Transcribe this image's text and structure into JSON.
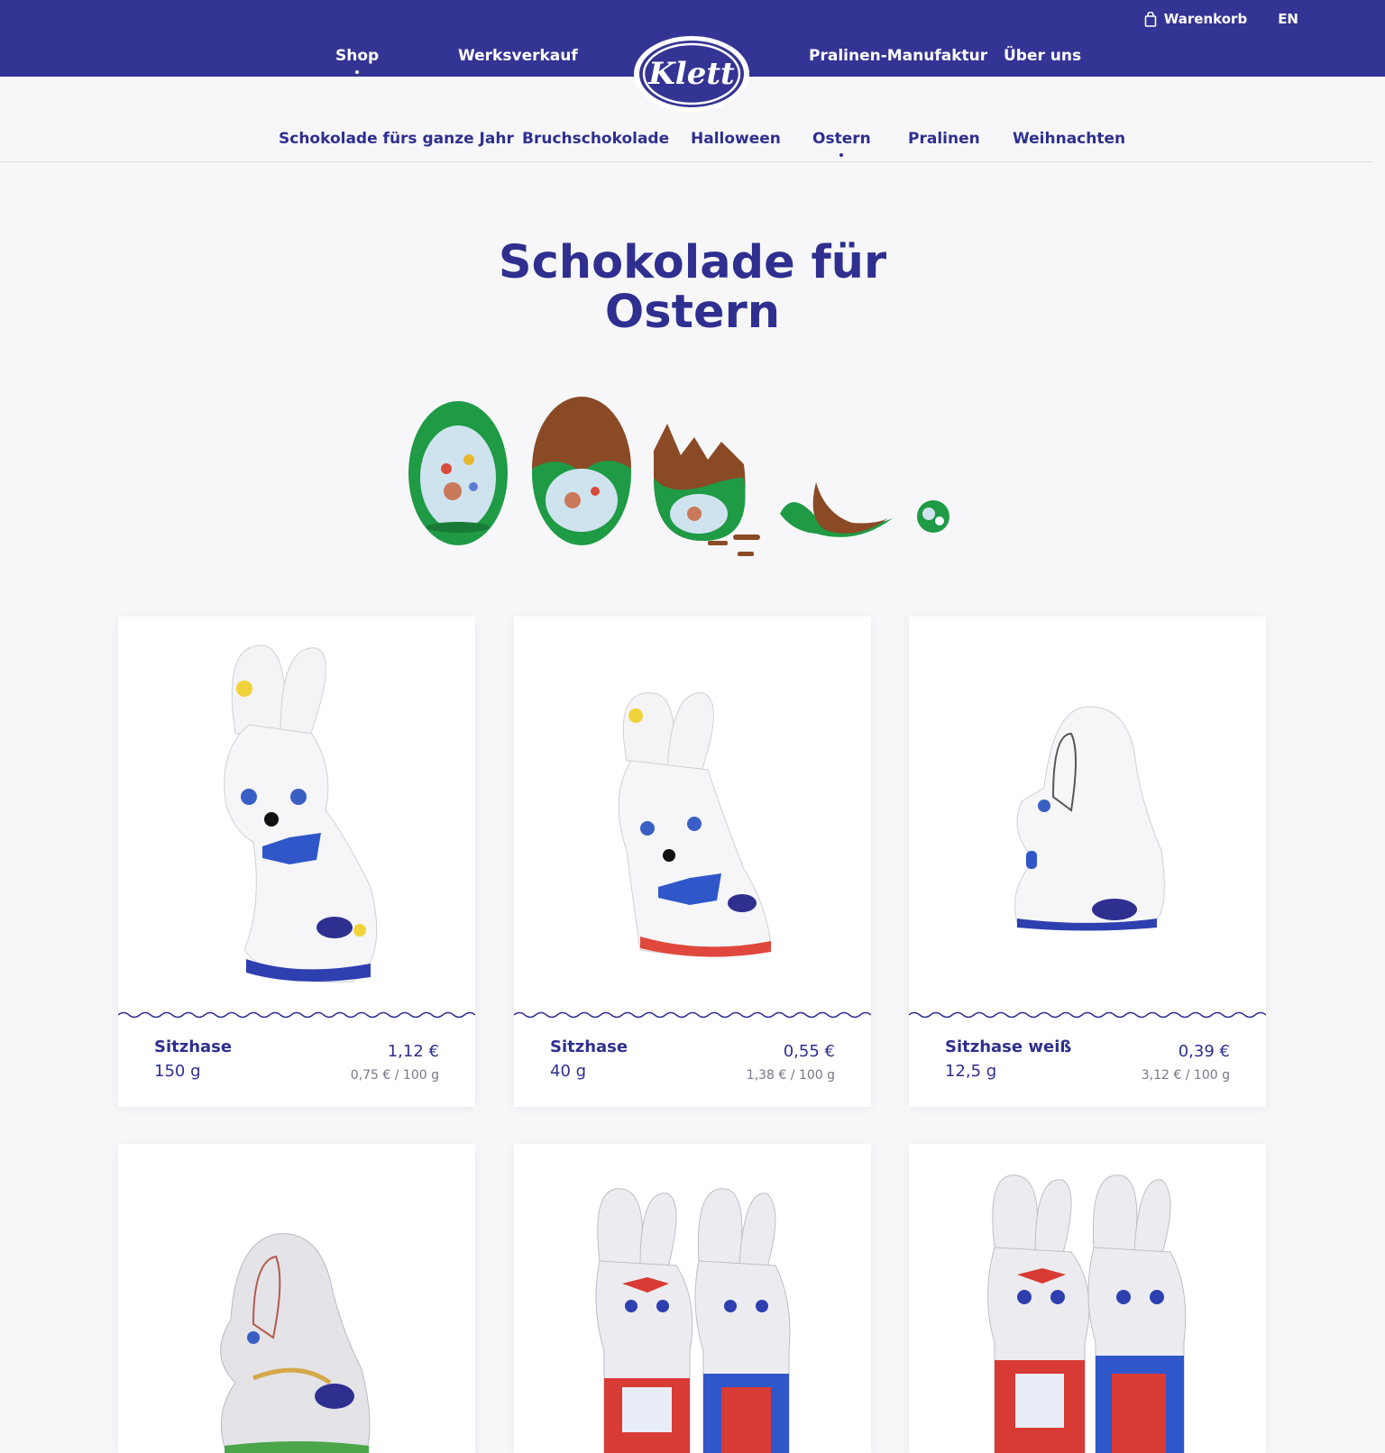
{
  "header": {
    "cart_label": "Warenkorb",
    "lang_label": "EN",
    "logo_text": "Klett",
    "main_nav": [
      "Shop",
      "Werksverkauf",
      "Pralinen-Manufaktur",
      "Über uns"
    ],
    "active_main": "Shop"
  },
  "sub_nav": {
    "items": [
      "Schokolade fürs ganze Jahr",
      "Bruchschokolade",
      "Halloween",
      "Ostern",
      "Pralinen",
      "Weihnachten"
    ],
    "active": "Ostern"
  },
  "page": {
    "title_line1": "Schokolade für",
    "title_line2": "Ostern"
  },
  "products": [
    {
      "name": "Sitzhase",
      "weight": "150 g",
      "price": "1,12 €",
      "unit_price": "0,75 € / 100 g"
    },
    {
      "name": "Sitzhase",
      "weight": "40 g",
      "price": "0,55 €",
      "unit_price": "1,38 € / 100 g"
    },
    {
      "name": "Sitzhase weiß",
      "weight": "12,5 g",
      "price": "0,39 €",
      "unit_price": "3,12 € / 100 g"
    },
    {
      "name": "",
      "weight": "",
      "price": "",
      "unit_price": ""
    },
    {
      "name": "",
      "weight": "",
      "price": "",
      "unit_price": ""
    },
    {
      "name": "",
      "weight": "",
      "price": "",
      "unit_price": ""
    }
  ],
  "colors": {
    "brand": "#343494",
    "text": "#2e2f8f",
    "background": "#f7f7f9",
    "card": "#ffffff",
    "foil_green": "#1f9a45",
    "chocolate": "#8a4a26"
  }
}
